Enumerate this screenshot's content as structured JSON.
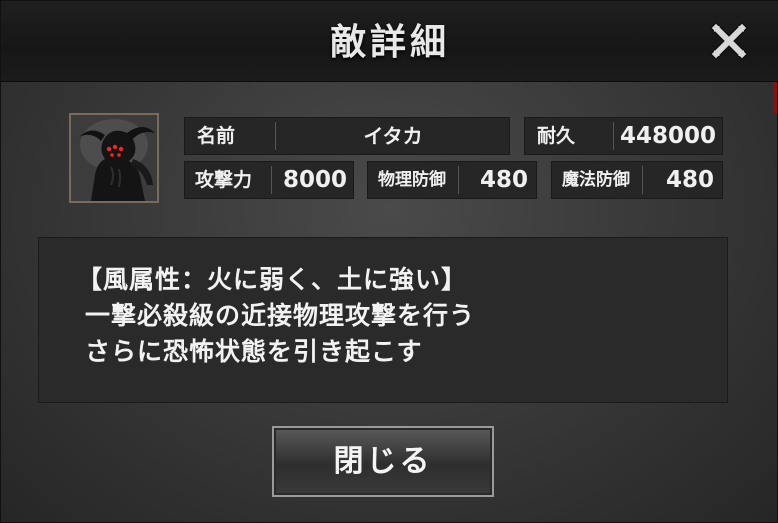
{
  "dialog": {
    "title": "敵詳細",
    "close_icon": "close-x-icon"
  },
  "enemy": {
    "portrait_icon": "shadow-creature-portrait",
    "name_label": "名前",
    "name_value": "イタカ",
    "hp_label": "耐久",
    "hp_value": "448000",
    "attack_label": "攻撃力",
    "attack_value": "8000",
    "phys_def_label": "物理防御",
    "phys_def_value": "480",
    "mag_def_label": "魔法防御",
    "mag_def_value": "480"
  },
  "description": {
    "lines": [
      "【風属性：火に弱く、土に強い】",
      "一撃必殺級の近接物理攻撃を行う",
      "さらに恐怖状態を引き起こす"
    ]
  },
  "footer": {
    "close_button_label": "閉じる"
  },
  "colors": {
    "background": "#3a3a3a",
    "header": "#1a1a1a",
    "text": "#f0f0f0",
    "accent_red": "#8a1010",
    "portrait_eyes": "#ff2020"
  }
}
